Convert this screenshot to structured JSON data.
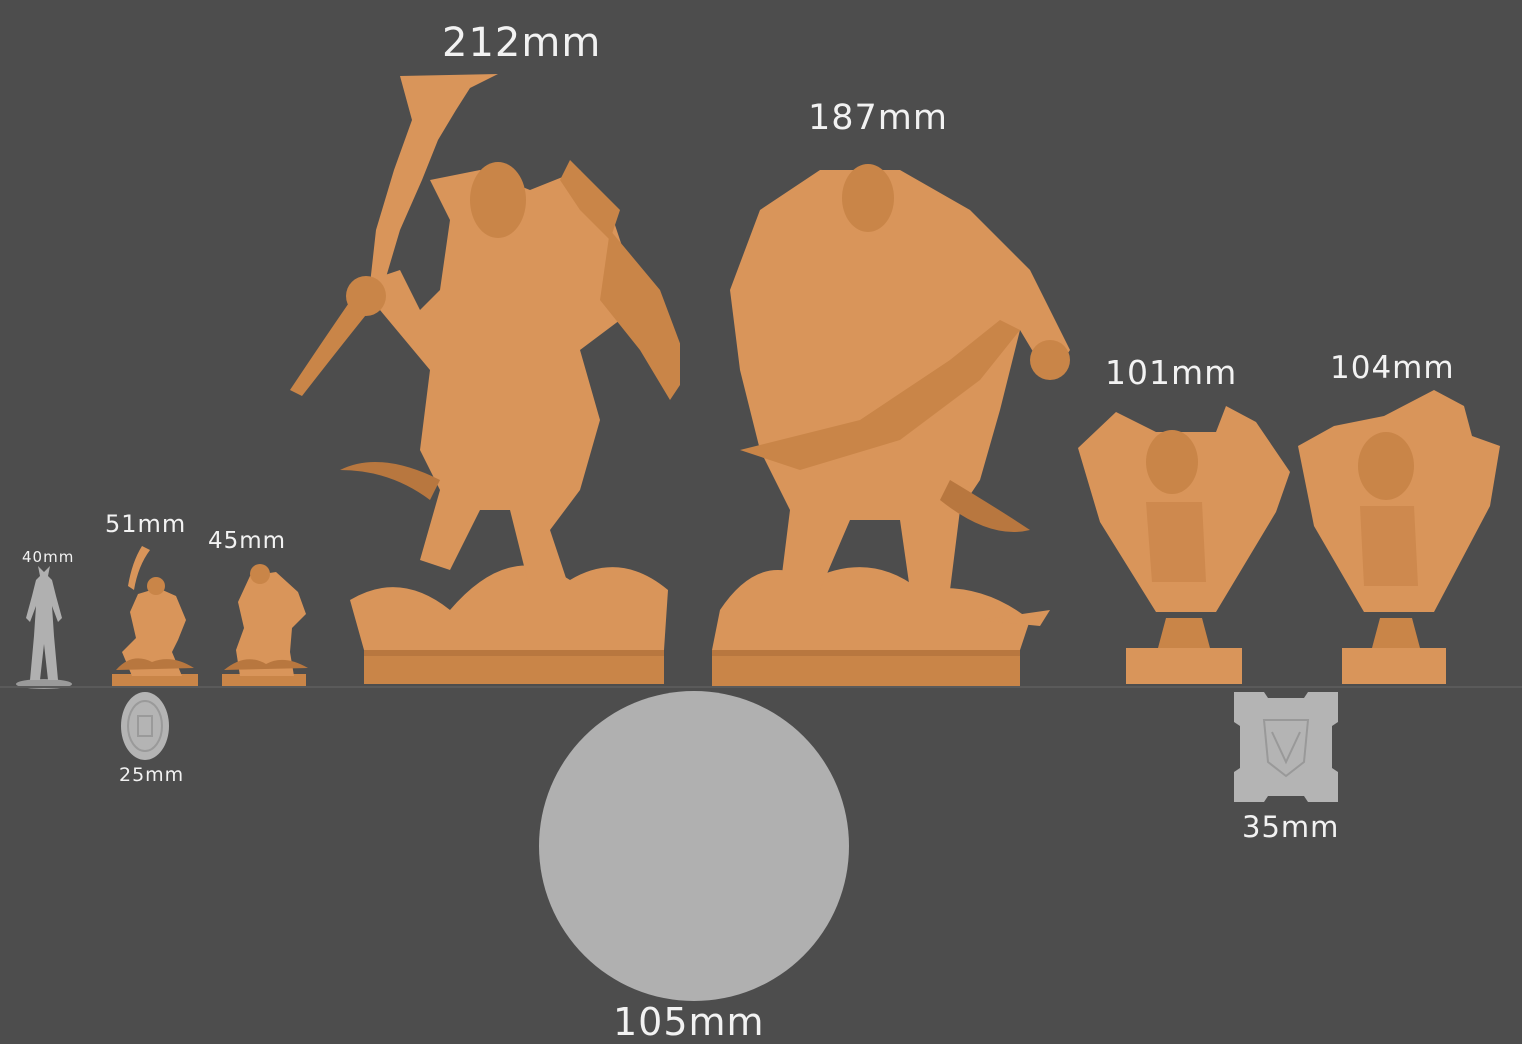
{
  "labels": {
    "l40": "40mm",
    "l51": "51mm",
    "l45": "45mm",
    "l212": "212mm",
    "l187": "187mm",
    "l101": "101mm",
    "l104": "104mm",
    "l25": "25mm",
    "l105": "105mm",
    "l35": "35mm"
  },
  "colors": {
    "background": "#4d4d4d",
    "resin_orange": "#d9955a",
    "resin_shadow": "#b8773f",
    "grey_reference": "#b0b0b0"
  }
}
